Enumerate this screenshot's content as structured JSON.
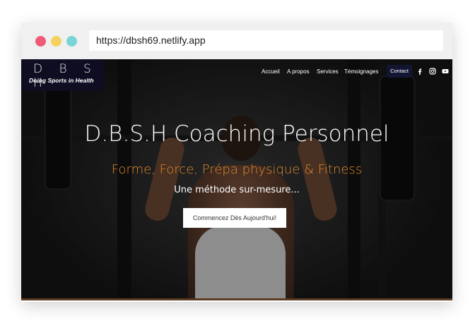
{
  "browser": {
    "url": "https://dbsh69.netlify.app",
    "window_controls": [
      "close",
      "minimize",
      "maximize"
    ]
  },
  "brand": {
    "title": "D B S H",
    "tagline": "Doing Sports in Health"
  },
  "nav": {
    "items": [
      "Accueil",
      "A propos",
      "Services",
      "Témoignages"
    ],
    "contact_label": "Contact",
    "social_icons": [
      "facebook-icon",
      "instagram-icon",
      "youtube-icon"
    ]
  },
  "hero": {
    "title": "D.B.S.H Coaching Personnel",
    "subtitle": "Forme, Force, Prépa physique & Fitness",
    "tagline": "Une méthode sur-mesure...",
    "cta_label": "Commencez Dès Aujourd'hui!"
  },
  "colors": {
    "accent": "#e08a2c",
    "nav_dark": "#0e0d22"
  }
}
